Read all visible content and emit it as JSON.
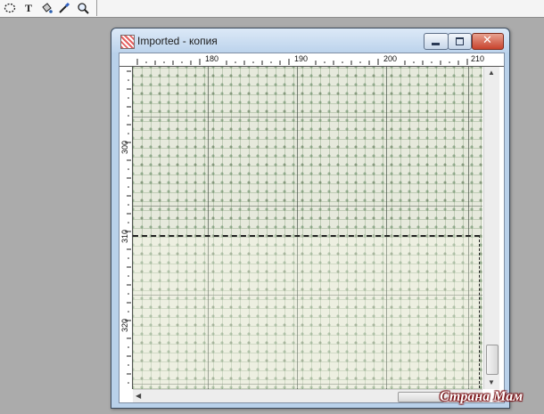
{
  "toolbar": {
    "tools": [
      {
        "name": "lasso-select-icon"
      },
      {
        "name": "text-tool-icon",
        "glyph": "T"
      },
      {
        "name": "fill-bucket-icon"
      },
      {
        "name": "eyedropper-icon"
      },
      {
        "name": "zoom-icon"
      }
    ]
  },
  "window": {
    "title": "Imported - копия",
    "controls": [
      "minimize-icon",
      "maximize-icon",
      "close-icon"
    ]
  },
  "ruler": {
    "horizontal_labels": [
      "180",
      "190",
      "200",
      "210"
    ],
    "vertical_labels": [
      "300",
      "310",
      "320"
    ]
  },
  "colors": {
    "desktop_bg": "#ababab",
    "title_bar": "#bcd3ec",
    "close_button": "#c8432d",
    "pattern_bg": "#e6e9dc",
    "selection_border": "#222222"
  },
  "watermark": {
    "text": "Страна Мам"
  }
}
